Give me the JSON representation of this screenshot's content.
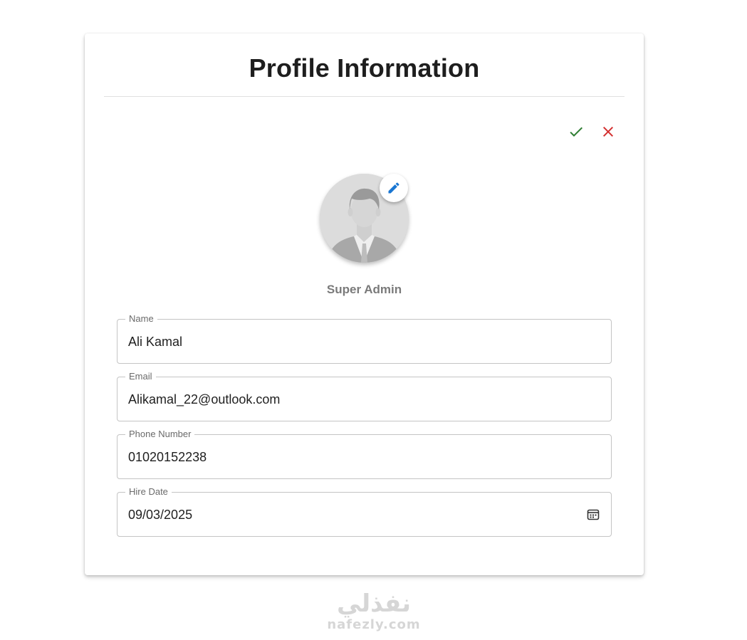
{
  "page": {
    "title": "Profile Information",
    "role": "Super Admin"
  },
  "actions": {
    "confirm_icon": "check-icon",
    "cancel_icon": "close-icon",
    "confirm_color": "#2e7d32",
    "cancel_color": "#d32f2f"
  },
  "avatar": {
    "edit_icon": "pencil-icon",
    "edit_color": "#1976d2"
  },
  "fields": [
    {
      "label": "Name",
      "value": "Ali Kamal"
    },
    {
      "label": "Email",
      "value": "Alikamal_22@outlook.com"
    },
    {
      "label": "Phone Number",
      "value": "01020152238"
    },
    {
      "label": "Hire Date",
      "value": "09/03/2025",
      "icon": "calendar-icon"
    }
  ],
  "watermark": {
    "arabic": "نفذلي",
    "latin": "nafezly.com"
  }
}
